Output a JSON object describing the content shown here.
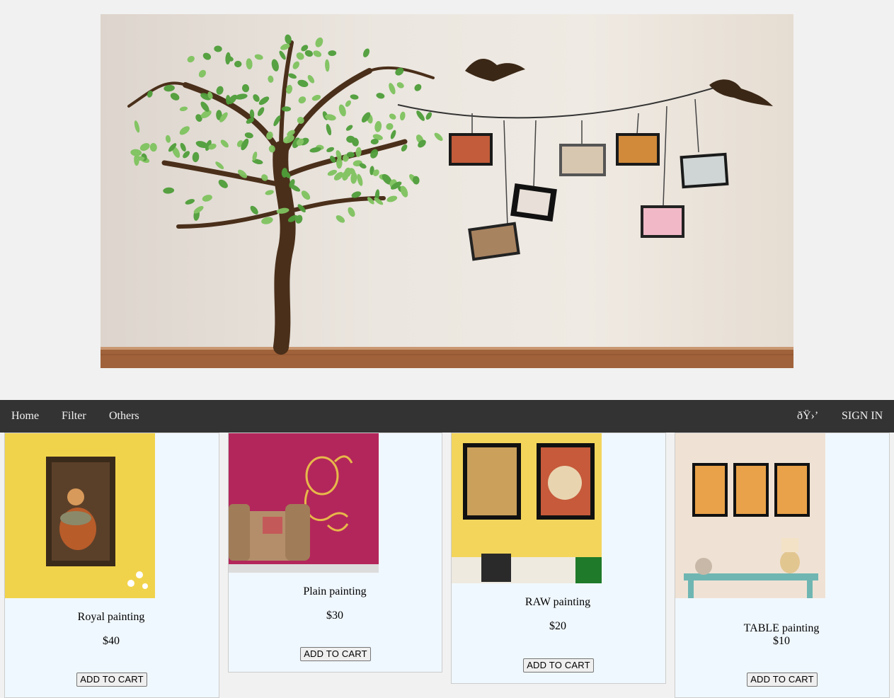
{
  "nav": {
    "left_links": [
      "Home",
      "Filter",
      "Others"
    ],
    "icon_text": "ðŸ›’",
    "signin_label": "SIGN IN"
  },
  "products": [
    {
      "name": "Royal painting",
      "price": "$40",
      "button": "ADD TO CART"
    },
    {
      "name": "Plain painting",
      "price": "$30",
      "button": "ADD TO CART"
    },
    {
      "name": "RAW painting",
      "price": "$20",
      "button": "ADD TO CART"
    },
    {
      "name": "TABLE painting",
      "price": "$10",
      "button": "ADD TO CART"
    }
  ],
  "colors": {
    "nav_bg": "#333333",
    "card_bg": "#f0f8ff",
    "page_bg": "#f1f1f1"
  }
}
